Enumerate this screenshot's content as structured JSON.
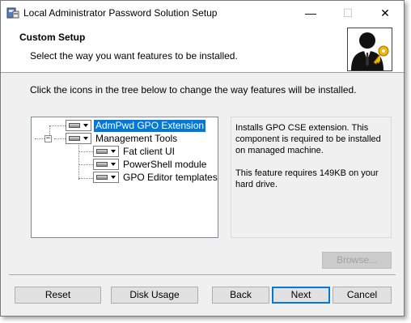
{
  "window": {
    "title": "Local Administrator Password Solution Setup",
    "controls": {
      "minimize": "—",
      "maximize": "☐",
      "close": "✕"
    }
  },
  "banner": {
    "title": "Custom Setup",
    "subtitle": "Select the way you want features to be installed."
  },
  "instructions": "Click the icons in the tree below to change the way features will be installed.",
  "tree": {
    "items": [
      {
        "label": "AdmPwd GPO Extension",
        "selected": true,
        "level": 0
      },
      {
        "label": "Management Tools",
        "selected": false,
        "level": 0,
        "expanded": true
      },
      {
        "label": "Fat client UI",
        "selected": false,
        "level": 1
      },
      {
        "label": "PowerShell module",
        "selected": false,
        "level": 1
      },
      {
        "label": "GPO Editor templates",
        "selected": false,
        "level": 1
      }
    ]
  },
  "description": {
    "text": "Installs GPO CSE extension. This component is required to be installed on managed machine.",
    "size_note": "This feature requires 149KB on your hard drive."
  },
  "buttons": {
    "browse": "Browse...",
    "reset": "Reset",
    "disk_usage": "Disk Usage",
    "back": "Back",
    "next": "Next",
    "cancel": "Cancel"
  },
  "colors": {
    "selection": "#0078d7",
    "dialog_bg": "#f0f0f0"
  },
  "icons": {
    "app": "installer-icon",
    "banner": "admin-key-icon"
  }
}
